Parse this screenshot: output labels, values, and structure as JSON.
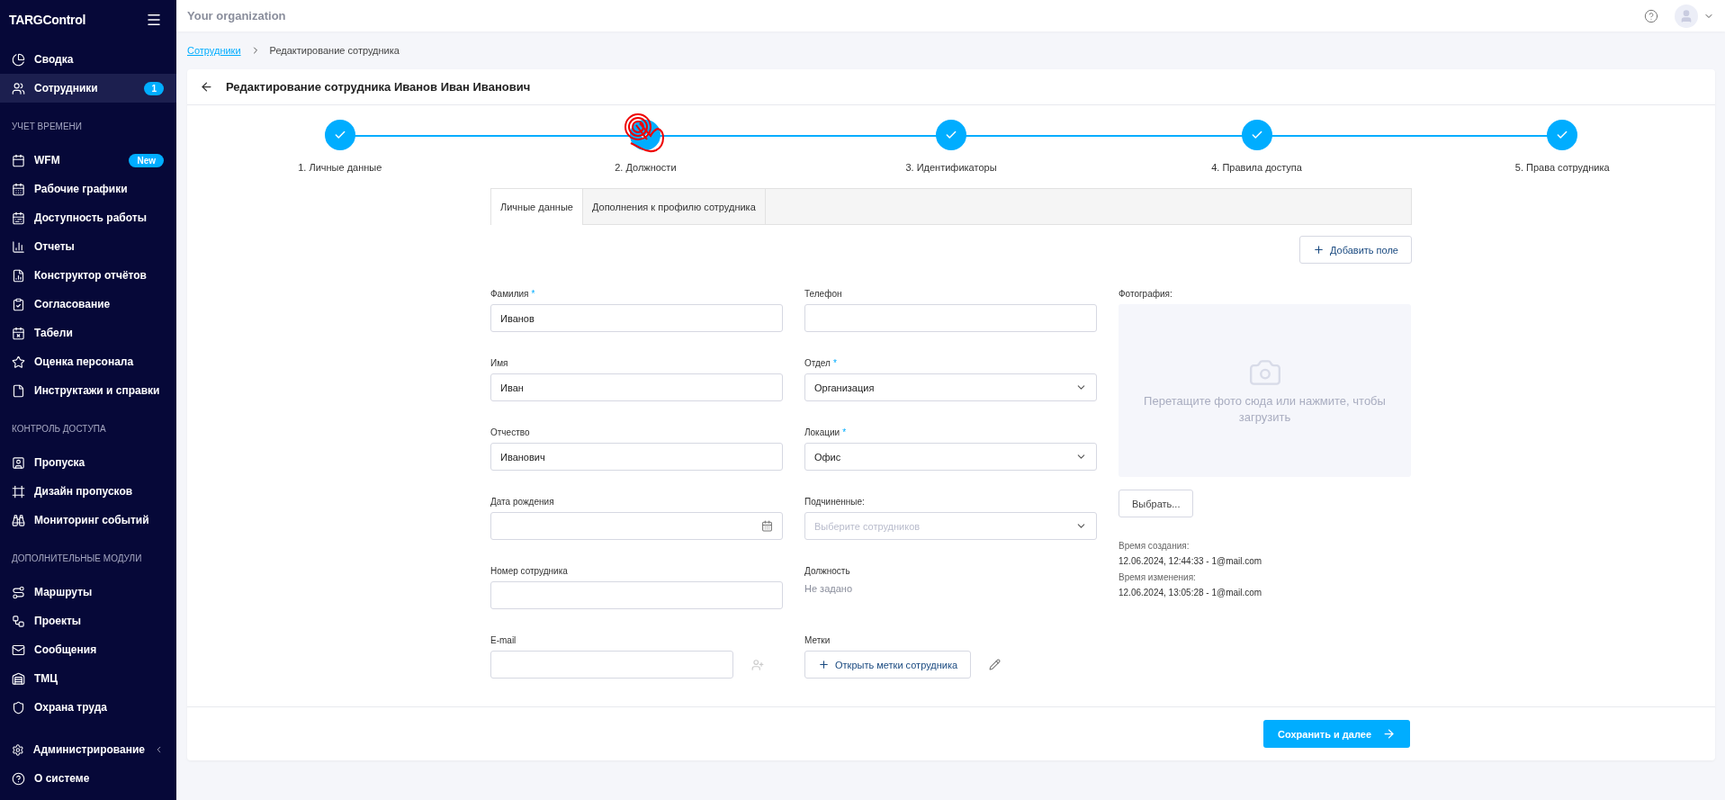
{
  "sidebar": {
    "logo": "TARGControl",
    "sections": [
      {
        "items": [
          {
            "label": "Сводка",
            "selected": false
          },
          {
            "label": "Сотрудники",
            "selected": true,
            "badge": "1"
          }
        ]
      },
      {
        "heading": "УЧЕТ ВРЕМЕНИ",
        "items": [
          {
            "label": "WFM",
            "selected": false,
            "badge": "New"
          },
          {
            "label": "Рабочие графики",
            "selected": false
          },
          {
            "label": "Доступность работы",
            "selected": false
          },
          {
            "label": "Отчеты",
            "selected": false
          },
          {
            "label": "Конструктор отчётов",
            "selected": false
          },
          {
            "label": "Согласование",
            "selected": false
          },
          {
            "label": "Табели",
            "selected": false
          },
          {
            "label": "Оценка персонала",
            "selected": false
          },
          {
            "label": "Инструктажи и справки",
            "selected": false
          }
        ]
      },
      {
        "heading": "КОНТРОЛЬ ДОСТУПА",
        "items": [
          {
            "label": "Пропуска",
            "selected": false
          },
          {
            "label": "Дизайн пропусков",
            "selected": false
          },
          {
            "label": "Мониторинг событий",
            "selected": false
          }
        ]
      },
      {
        "heading": "ДОПОЛНИТЕЛЬНЫЕ МОДУЛИ",
        "items": [
          {
            "label": "Маршруты",
            "selected": false
          },
          {
            "label": "Проекты",
            "selected": false
          },
          {
            "label": "Сообщения",
            "selected": false
          },
          {
            "label": "ТМЦ",
            "selected": false
          },
          {
            "label": "Охрана труда",
            "selected": false
          }
        ]
      },
      {
        "items": [
          {
            "label": "Администрирование",
            "selected": false,
            "submenu": true
          },
          {
            "label": "О системе",
            "selected": false,
            "submenu": false
          }
        ]
      }
    ]
  },
  "topbar": {
    "organization": "Your organization"
  },
  "breadcrumb": [
    {
      "label": "Сотрудники",
      "link": true
    },
    {
      "label": "Редактирование сотрудника",
      "link": false
    }
  ],
  "card": {
    "title": "Редактирование сотрудника Иванов Иван Иванович",
    "steps": [
      {
        "label": "1. Личные данные",
        "done": true,
        "click_marker": false
      },
      {
        "label": "2. Должности",
        "done": true,
        "click_marker": true
      },
      {
        "label": "3. Идентификаторы",
        "done": true,
        "click_marker": false
      },
      {
        "label": "4. Правила доступа",
        "done": true,
        "click_marker": false
      },
      {
        "label": "5. Права сотрудника",
        "done": true,
        "click_marker": false
      }
    ],
    "tabs": [
      {
        "label": "Личные данные",
        "selected": true
      },
      {
        "label": "Дополнения к профилю сотрудника",
        "selected": false
      }
    ],
    "add_field_button": "Добавить поле",
    "column_1": [
      {
        "kind": "input",
        "label": "Фамилия",
        "required_mark": "*",
        "value": "Иванов"
      },
      {
        "kind": "input",
        "label": "Имя",
        "value": "Иван"
      },
      {
        "kind": "input",
        "label": "Отчество",
        "value": "Иванович"
      },
      {
        "kind": "date",
        "label": "Дата рождения"
      },
      {
        "kind": "input",
        "label": "Номер сотрудника"
      },
      {
        "kind": "email",
        "label": "E-mail"
      }
    ],
    "column_2": [
      {
        "kind": "input",
        "label": "Телефон"
      },
      {
        "kind": "select",
        "label": "Отдел",
        "required_mark": "*",
        "value": "Организация"
      },
      {
        "kind": "select",
        "label": "Локации",
        "required_mark": "*",
        "value": "Офис"
      },
      {
        "kind": "select",
        "label": "Подчиненные:",
        "placeholder": "Выберите сотрудников"
      },
      {
        "kind": "static",
        "label": "Должность",
        "value": "Не задано"
      },
      {
        "kind": "tags",
        "label": "Метки",
        "button": "Открыть метки сотрудника"
      }
    ],
    "photo": {
      "label": "Фотография:",
      "hint": "Перетащите фото сюда или нажмите, чтобы загрузить",
      "button": "Выбрать..."
    },
    "meta": [
      {
        "label": "Время создания:",
        "value": "12.06.2024, 12:44:33 - 1@mail.com"
      },
      {
        "label": "Время изменения:",
        "value": "12.06.2024, 13:05:28 - 1@mail.com"
      }
    ],
    "save_button": "Сохранить и далее"
  }
}
